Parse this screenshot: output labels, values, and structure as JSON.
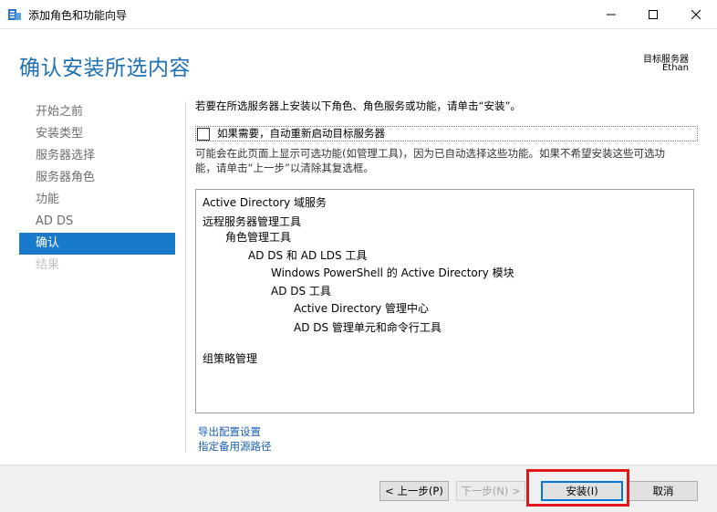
{
  "window": {
    "title": "添加角色和功能向导",
    "minimize_icon": "minimize-icon",
    "maximize_icon": "maximize-icon",
    "close_icon": "close-icon"
  },
  "header": {
    "page_title": "确认安装所选内容",
    "target_label": "目标服务器",
    "target_name": "Ethan"
  },
  "nav": {
    "items": [
      {
        "label": "开始之前",
        "state": "normal"
      },
      {
        "label": "安装类型",
        "state": "normal"
      },
      {
        "label": "服务器选择",
        "state": "normal"
      },
      {
        "label": "服务器角色",
        "state": "normal"
      },
      {
        "label": "功能",
        "state": "normal"
      },
      {
        "label": "AD DS",
        "state": "normal"
      },
      {
        "label": "确认",
        "state": "active"
      },
      {
        "label": "结果",
        "state": "disabled"
      }
    ]
  },
  "main": {
    "intro": "若要在所选服务器上安装以下角色、角色服务或功能，请单击“安装”。",
    "restart_checkbox": {
      "label": "如果需要，自动重新启动目标服务器",
      "checked": false
    },
    "note_line1": "可能会在此页面上显示可选功能(如管理工具)，因为已自动选择这些功能。如果不希望安装这些可选功",
    "note_line2": "能，请单击“上一步”以清除其复选框。",
    "features": [
      {
        "label": "Active Directory 域服务",
        "level": 0
      },
      {
        "label": "远程服务器管理工具",
        "level": 0
      },
      {
        "label": "角色管理工具",
        "level": 1
      },
      {
        "label": "AD DS 和 AD LDS 工具",
        "level": 2
      },
      {
        "label": "Windows PowerShell 的 Active Directory 模块",
        "level": 3
      },
      {
        "label": "AD DS 工具",
        "level": 3
      },
      {
        "label": "Active Directory 管理中心",
        "level": 4
      },
      {
        "label": "AD DS 管理单元和命令行工具",
        "level": 4
      },
      {
        "label": "组策略管理",
        "level": 0
      }
    ],
    "links": {
      "export": "导出配置设置",
      "alt_source": "指定备用源路径"
    }
  },
  "footer": {
    "prev_label": "< 上一步(P)",
    "next_label": "下一步(N) >",
    "install_label": "安装(I)",
    "cancel_label": "取消",
    "highlight_color": "#e0181c"
  },
  "colors": {
    "accent": "#1979ca",
    "title_blue": "#1e6fb4",
    "link_blue": "#1a5fb4"
  }
}
